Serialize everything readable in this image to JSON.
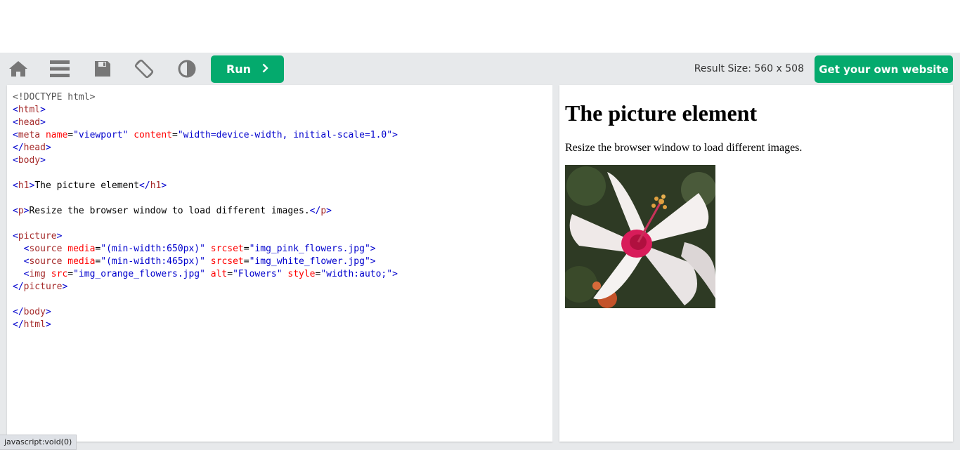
{
  "toolbar": {
    "icons": [
      "home-icon",
      "menu-icon",
      "save-icon",
      "rotate-icon",
      "contrast-icon"
    ],
    "run_label": "Run",
    "result_size": "Result Size: 560 x 508",
    "own_website_label": "Get your own website",
    "accent_color": "#04aa6d"
  },
  "editor": {
    "lines": [
      "<!DOCTYPE html>",
      "<html>",
      "<head>",
      "<meta name=\"viewport\" content=\"width=device-width, initial-scale=1.0\">",
      "</head>",
      "<body>",
      "",
      "<h1>The picture element</h1>",
      "",
      "<p>Resize the browser window to load different images.</p>",
      "",
      "<picture>",
      "  <source media=\"(min-width:650px)\" srcset=\"img_pink_flowers.jpg\">",
      "  <source media=\"(min-width:465px)\" srcset=\"img_white_flower.jpg\">",
      "  <img src=\"img_orange_flowers.jpg\" alt=\"Flowers\" style=\"width:auto;\">",
      "</picture>",
      "",
      "</body>",
      "</html>"
    ]
  },
  "result": {
    "heading": "The picture element",
    "paragraph": "Resize the browser window to load different images.",
    "image_alt": "Flowers"
  },
  "status_bar": {
    "link_text": "javascript:void(0)"
  }
}
